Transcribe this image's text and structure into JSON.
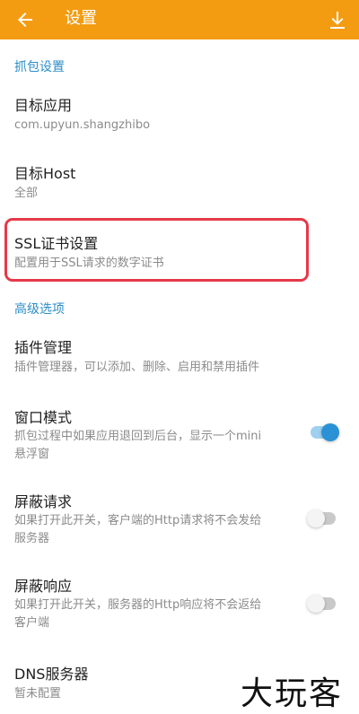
{
  "appbar": {
    "title": "设置",
    "accent_color": "#f39c12",
    "back_icon": "arrow-left-icon",
    "download_icon": "download-icon"
  },
  "sections": {
    "capture": {
      "header": "抓包设置",
      "target_app": {
        "title": "目标应用",
        "value": "com.upyun.shangzhibo"
      },
      "target_host": {
        "title": "目标Host",
        "value": "全部"
      },
      "ssl": {
        "title": "SSL证书设置",
        "value": "配置用于SSL请求的数字证书"
      }
    },
    "advanced": {
      "header": "高级选项",
      "plugins": {
        "title": "插件管理",
        "value": "插件管理器，可以添加、删除、启用和禁用插件"
      },
      "window_mode": {
        "title": "窗口模式",
        "line1": "抓包过程中如果应用退回到后台，显示一个mini",
        "line2": "悬浮窗",
        "enabled": true
      },
      "block_request": {
        "title": "屏蔽请求",
        "line1": "如果打开此开关，客户端的Http请求将不会发给",
        "line2": "服务器",
        "enabled": false
      },
      "block_response": {
        "title": "屏蔽响应",
        "line1": "如果打开此开关，服务器的Http响应将不会返给",
        "line2": "客户端",
        "enabled": false
      },
      "dns": {
        "title": "DNS服务器",
        "value": "暂未配置"
      }
    }
  },
  "watermark": "大玩客"
}
